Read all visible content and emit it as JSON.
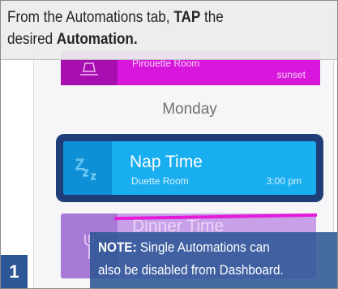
{
  "instruction": {
    "part1": "From the Automations tab, ",
    "tap": "TAP",
    "part2": " the",
    "part3": "desired ",
    "automation": "Automation."
  },
  "automations_list": {
    "previous_card": {
      "room": "Pirouette Room",
      "time": "sunset",
      "color": "#d817dc",
      "icon": "lamp-icon"
    },
    "day_heading": "Monday",
    "selected_card": {
      "title": "Nap Time",
      "room": "Duette Room",
      "time": "3:00 pm",
      "color": "#19aef0",
      "icon": "zzz-icon"
    },
    "next_card": {
      "title": "Dinner Time",
      "color": "#c8a0e8",
      "icon": "fork-icon"
    }
  },
  "note": {
    "label": "NOTE:",
    "line1": " Single Automations can",
    "line2": "also be disabled from Dashboard."
  },
  "step_number": "1",
  "colors": {
    "note_bg": "#2c5696",
    "selection_ring": "#1f3e78"
  }
}
